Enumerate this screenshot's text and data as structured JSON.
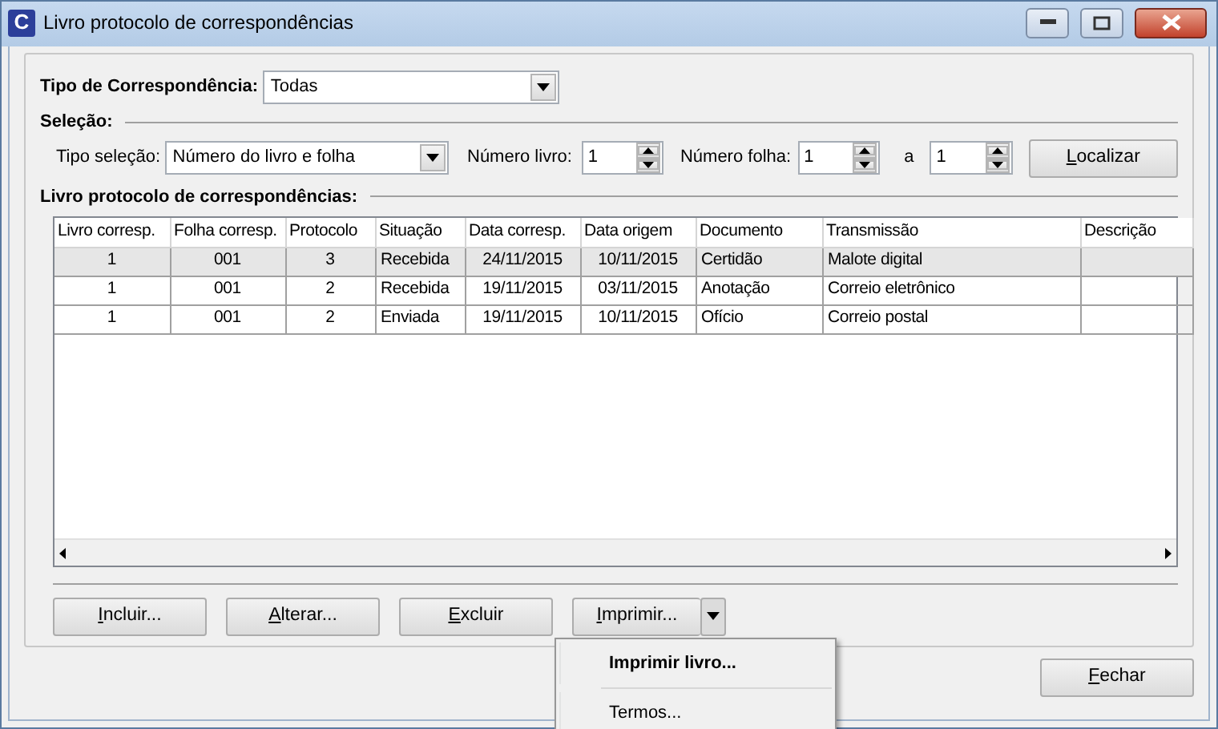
{
  "window": {
    "title": "Livro protocolo de correspondências",
    "icon_letter": "C"
  },
  "tipo_correspondencia": {
    "label": "Tipo de Correspondência:",
    "value": "Todas"
  },
  "selecao": {
    "heading": "Seleção:",
    "tipo_label": "Tipo seleção:",
    "tipo_value": "Número do livro e folha",
    "numero_livro_label": "Número livro:",
    "numero_livro": "1",
    "numero_folha_label": "Número folha:",
    "numero_folha": "1",
    "a_label": "a",
    "ate": "1",
    "search_button": "Localizar"
  },
  "table": {
    "heading": "Livro protocolo de correspondências:",
    "columns": [
      "Livro corresp.",
      "Folha corresp.",
      "Protocolo",
      "Situação",
      "Data corresp.",
      "Data origem",
      "Documento",
      "Transmissão",
      "Descrição"
    ],
    "rows": [
      {
        "selected": true,
        "cells": [
          "1",
          "001",
          "3",
          "Recebida",
          "24/11/2015",
          "10/11/2015",
          "Certidão",
          "Malote digital",
          ""
        ]
      },
      {
        "selected": false,
        "cells": [
          "1",
          "001",
          "2",
          "Recebida",
          "19/11/2015",
          "03/11/2015",
          "Anotação",
          "Correio eletrônico",
          ""
        ]
      },
      {
        "selected": false,
        "cells": [
          "1",
          "001",
          "2",
          "Enviada",
          "19/11/2015",
          "10/11/2015",
          "Ofício",
          "Correio postal",
          ""
        ]
      }
    ]
  },
  "buttons": [
    "Incluir...",
    "Alterar...",
    "Excluir"
  ],
  "print_button": {
    "label": "Imprimir...",
    "expanded": true
  },
  "print_menu": [
    {
      "label": "Imprimir livro...",
      "default": true
    },
    {
      "label": "Termos...",
      "default": false
    }
  ],
  "close_button": "Fechar"
}
